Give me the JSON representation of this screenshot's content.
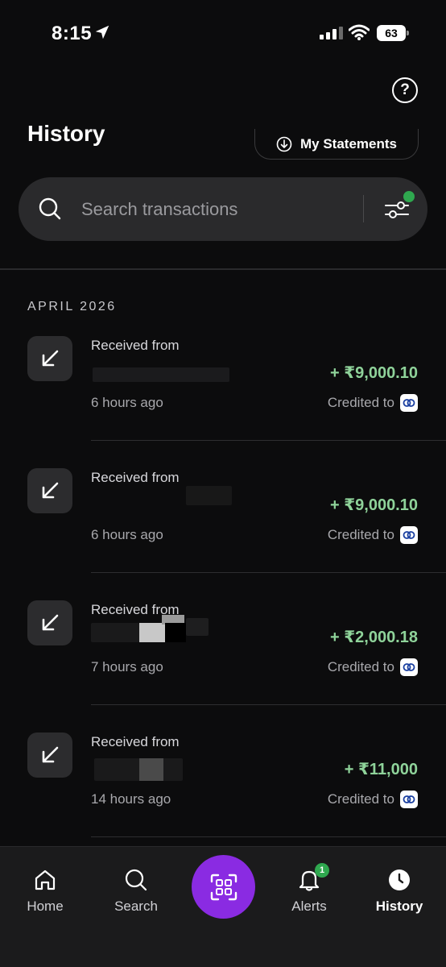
{
  "status_bar": {
    "time": "8:15",
    "battery": "63"
  },
  "header": {
    "title": "History",
    "statements_label": "My Statements"
  },
  "search": {
    "placeholder": "Search transactions"
  },
  "month": "APRIL 2026",
  "transactions": [
    {
      "label": "Received from",
      "time": "6 hours ago",
      "amount": "+ ₹9,000.10",
      "credited": "Credited to"
    },
    {
      "label": "Received from",
      "time": "6 hours ago",
      "amount": "+ ₹9,000.10",
      "credited": "Credited to"
    },
    {
      "label": "Received from",
      "time": "7 hours ago",
      "amount": "+ ₹2,000.18",
      "credited": "Credited to"
    },
    {
      "label": "Received from",
      "time": "14 hours ago",
      "amount": "+ ₹11,000",
      "credited": "Credited to"
    }
  ],
  "nav": {
    "home": "Home",
    "search": "Search",
    "alerts": "Alerts",
    "alerts_badge": "1",
    "history": "History"
  },
  "colors": {
    "accent": "#8a2be2",
    "credit": "#8fd39a",
    "badge": "#2fa84f"
  }
}
